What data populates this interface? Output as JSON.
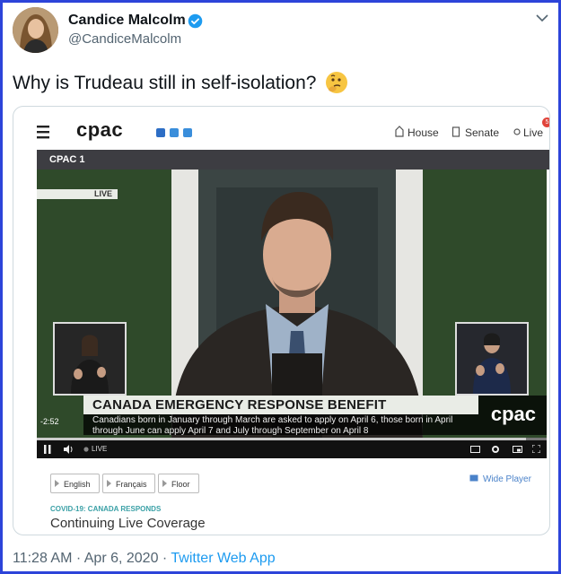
{
  "tweet": {
    "author_name": "Candice Malcolm",
    "author_handle": "@CandiceMalcolm",
    "text": "Why is Trudeau still in self-isolation?",
    "emoji": "thinking-face",
    "timestamp": "11:28 AM · Apr 6, 2020 · ",
    "source_app": "Twitter Web App"
  },
  "cpac": {
    "logo": "cpac",
    "nav": {
      "house": "House",
      "senate": "Senate",
      "live": "Live",
      "live_count": "5"
    },
    "channel": "CPAC 1",
    "video": {
      "live_tag": "LIVE",
      "headline": "CANADA EMERGENCY RESPONSE BENEFIT",
      "subtext": "Canadians born in January through March are asked to apply on April 6, those born in April through June can apply April 7 and July through September on April 8",
      "overlay_logo": "cpac",
      "time_remaining": "-2:52",
      "control_live": "LIVE",
      "progress": 0.96
    },
    "language_buttons": [
      "English",
      "Français",
      "Floor"
    ],
    "wide_player": "Wide Player",
    "category": "COVID-19: CANADA RESPONDS",
    "program_title": "Continuing Live Coverage"
  },
  "colors": {
    "frame": "#2d44d9",
    "verified": "#1d9bf0",
    "link": "#1d9bf0",
    "cpac_accent": "#3aa0a6"
  }
}
